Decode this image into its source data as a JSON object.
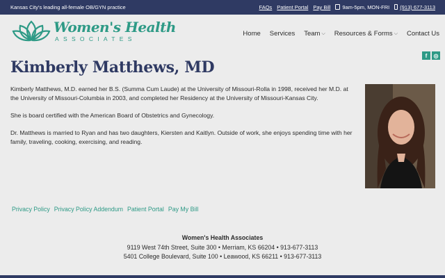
{
  "topbar": {
    "tagline": "Kansas City's leading all-female OB/GYN practice",
    "faqs": "FAQs",
    "patient_portal": "Patient Portal",
    "pay_bill": "Pay Bill",
    "hours": "9am-5pm, MON-FRI",
    "phone": "(913) 677-3113"
  },
  "logo": {
    "title": "Women's Health",
    "subtitle": "ASSOCIATES"
  },
  "nav": {
    "home": "Home",
    "services": "Services",
    "team": "Team",
    "resources": "Resources & Forms",
    "contact": "Contact Us"
  },
  "social": {
    "facebook": "f",
    "instagram": "◎"
  },
  "page": {
    "title": "Kimberly Matthews, MD",
    "paragraphs": [
      "Kimberly Matthews, M.D. earned her B.S. (Summa Cum Laude) at the University of Missouri-Rolla in 1998, received her M.D. at the University of Missouri-Columbia in 2003, and completed her Residency at the University of Missouri-Kansas City.",
      "She is board certified with the American Board of Obstetrics and Gynecology.",
      "Dr. Matthews is married to Ryan and has two daughters, Kiersten and Kaitlyn. Outside of work, she enjoys spending time with her family, traveling, cooking, exercising, and reading."
    ]
  },
  "footer": {
    "links": [
      "Privacy Policy",
      "Privacy Policy Addendum",
      "Patient Portal",
      "Pay My Bill"
    ],
    "org_name": "Women's Health Associates",
    "address1": "9119 West 74th Street, Suite 300  •  Merriam, KS 66204  •  913-677-3113",
    "address2": "5401 College Boulevard, Suite 100  •  Leawood, KS 66211  •  913-677-3113"
  },
  "colors": {
    "navy": "#2f3a63",
    "teal": "#2e9a86",
    "background": "#ececec"
  }
}
